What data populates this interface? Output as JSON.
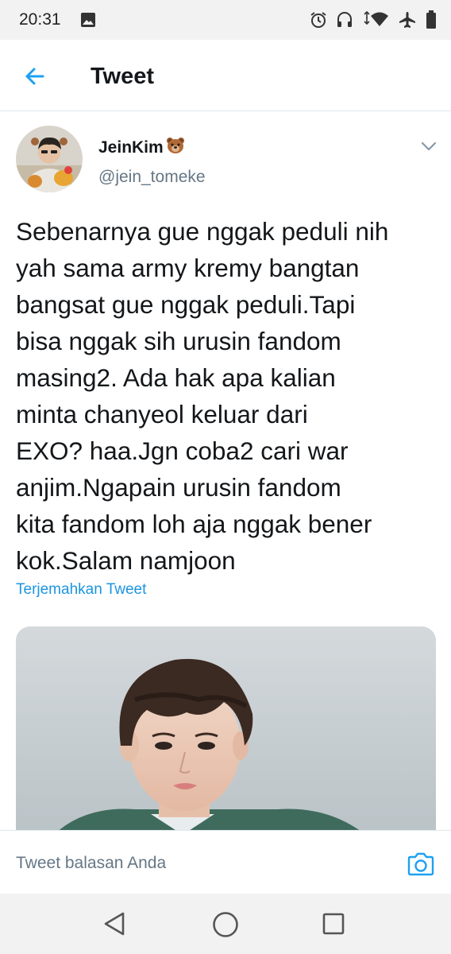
{
  "status_bar": {
    "time": "20:31",
    "left_icons": [
      "image-icon"
    ],
    "right_icons": [
      "alarm-icon",
      "headset-icon",
      "wifi-icon",
      "airplane-icon",
      "battery-icon"
    ]
  },
  "header": {
    "title": "Tweet",
    "back_icon": "arrow-left-icon",
    "accent_color": "#1da1f2"
  },
  "tweet": {
    "author": {
      "display_name": "JeinKim",
      "name_emoji": "🐻",
      "handle": "@jein_tomeke"
    },
    "text_lines": [
      "Sebenarnya gue nggak peduli nih",
      "yah sama army kremy bangtan",
      "bangsat gue nggak peduli.Tapi",
      "bisa nggak sih urusin fandom",
      "masing2. Ada hak apa kalian",
      "minta chanyeol keluar dari",
      "EXO? haa.Jgn coba2 cari war",
      "anjim.Ngapain urusin fandom",
      "kita fandom loh aja nggak bener",
      "kok.Salam namjoon"
    ],
    "translate_link": "Terjemahkan Tweet",
    "menu_icon": "chevron-down-icon",
    "media_description": "photo"
  },
  "reply_bar": {
    "placeholder": "Tweet balasan Anda",
    "camera_icon": "camera-icon"
  },
  "nav_bar": {
    "buttons": [
      "back-triangle-icon",
      "home-circle-icon",
      "recents-square-icon"
    ]
  }
}
